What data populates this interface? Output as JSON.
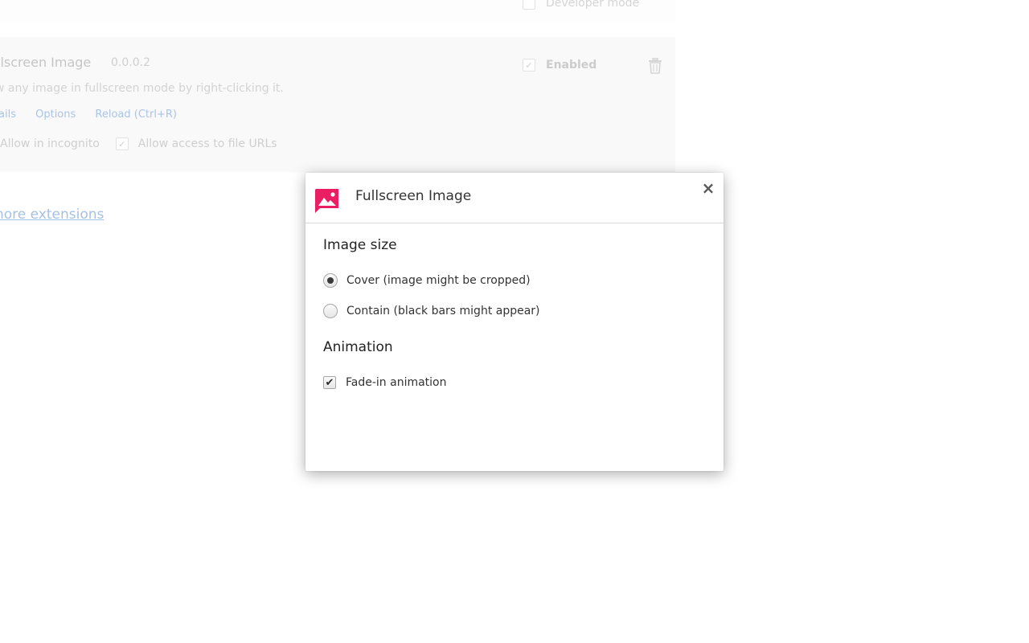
{
  "background": {
    "developer_mode_label": "Developer mode",
    "extension": {
      "name": "llscreen Image",
      "version": "0.0.0.2",
      "description": "w any image in fullscreen mode by right-clicking it.",
      "links": {
        "details": "ails",
        "options": "Options",
        "reload": "Reload (Ctrl+R)"
      },
      "allow_incognito": "Allow in incognito",
      "allow_file_urls": "Allow access to file URLs",
      "enabled_label": "Enabled"
    },
    "more_extensions_link": "hore extensions"
  },
  "dialog": {
    "title": "Fullscreen Image",
    "close_glyph": "×",
    "image_size": {
      "heading": "Image size",
      "options": [
        {
          "label": "Cover (image might be cropped)",
          "selected": true
        },
        {
          "label": "Contain (black bars might appear)",
          "selected": false
        }
      ]
    },
    "animation": {
      "heading": "Animation",
      "fade_in_label": "Fade-in animation",
      "fade_in_checked": true
    },
    "accent_color": "#e91e63"
  }
}
